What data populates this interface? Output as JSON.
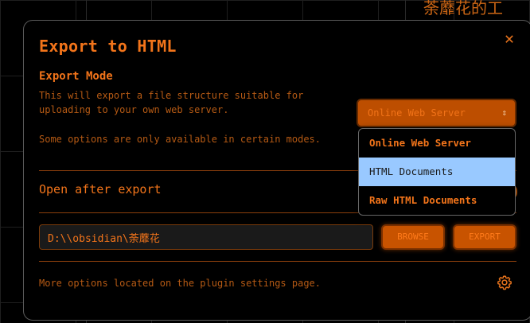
{
  "background": {
    "title_fragment": "荼蘼花的工"
  },
  "modal": {
    "title": "Export to HTML",
    "close_glyph": "✕",
    "export_mode": {
      "heading": "Export Mode",
      "description": "This will export a file structure suitable for uploading to your own web server.",
      "note": "Some options are only available in certain modes.",
      "selected": "Online Web Server",
      "options": [
        "Online Web Server",
        "HTML Documents",
        "Raw HTML Documents"
      ],
      "highlighted_option": "HTML Documents"
    },
    "open_after_export": {
      "label": "Open after export"
    },
    "path": {
      "value": "D:\\\\obsidian\\荼蘼花"
    },
    "browse_label": "BROWSE",
    "export_label": "EXPORT",
    "footer": "More options located on the plugin settings page."
  },
  "colors": {
    "accent": "#f2741a",
    "accent_dim": "#b65a14",
    "button_bg": "#c85300",
    "highlight": "#99c9ff",
    "background": "#000000"
  },
  "icons": {
    "close": "close-icon",
    "chevron": "chevron-up-down-icon",
    "settings": "gear-icon"
  }
}
